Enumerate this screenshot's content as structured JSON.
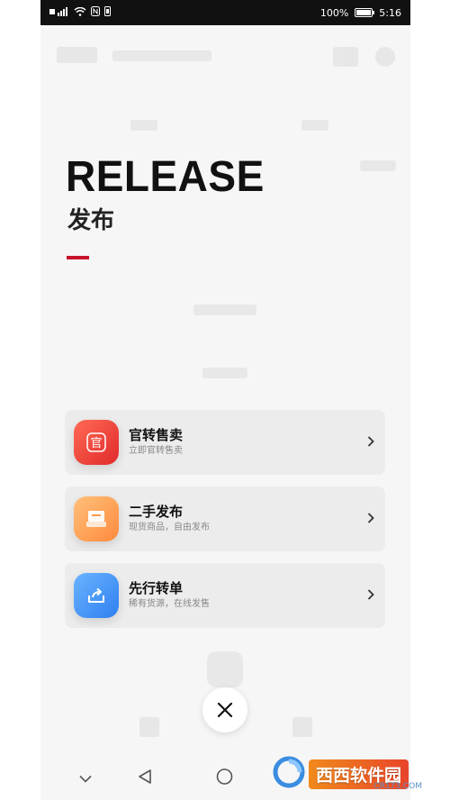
{
  "status_bar": {
    "left_icons": [
      "signal-icon",
      "wifi-icon",
      "nfc-icon",
      "notification-icon"
    ],
    "battery_percent": "100%",
    "time": "5:16"
  },
  "release": {
    "title": "RELEASE",
    "subtitle": "发布",
    "accent_color": "#c8142b"
  },
  "menu": [
    {
      "title": "官转售卖",
      "desc": "立即官转售卖",
      "icon_glyph": "官",
      "icon_color_from": "#ff5a4a",
      "icon_color_to": "#e02a2a"
    },
    {
      "title": "二手发布",
      "desc": "现货商品，自由发布",
      "icon_color_from": "#ffb36b",
      "icon_color_to": "#ff8a3d"
    },
    {
      "title": "先行转单",
      "desc": "稀有货源，在线发售",
      "icon_color_from": "#5aa8ff",
      "icon_color_to": "#2f7ff0"
    }
  ],
  "close_label": "close",
  "watermark": {
    "brand": "西西软件园",
    "site": "CR173.COM"
  }
}
